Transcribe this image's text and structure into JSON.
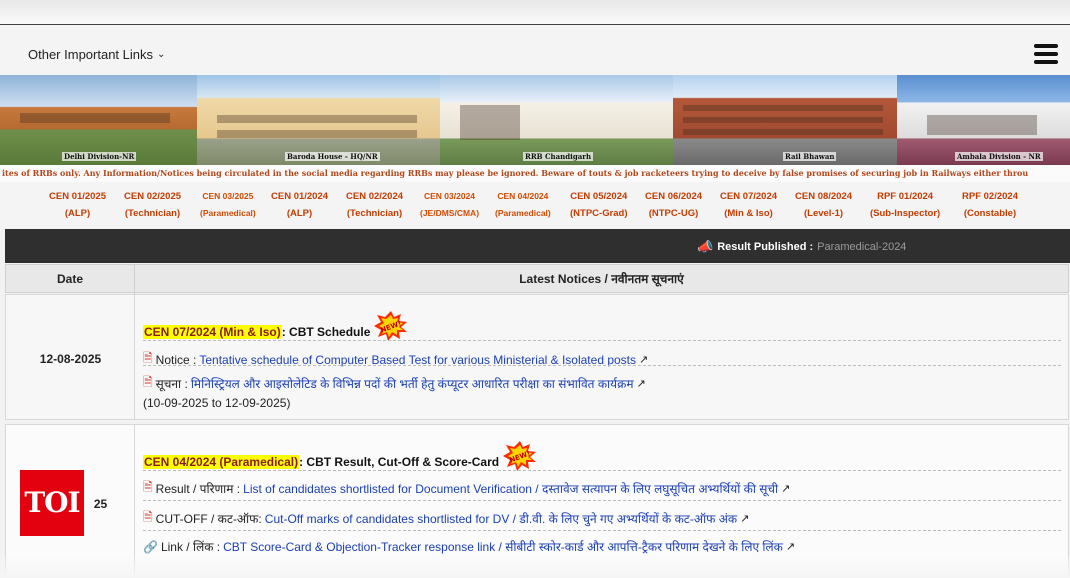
{
  "nav": {
    "links_label": "Other Important Links",
    "menu_icon": "hamburger-icon"
  },
  "banner": {
    "captions": [
      "Delhi Division-NR",
      "Baroda House - HQ/NR",
      "RRB Chandigarh",
      "Rail Bhawan",
      "Ambala Division - NR"
    ]
  },
  "ticker": "ites of RRBs only. Any Information/Notices being circulated in the social media regarding RRBs may please be ignored. Beware of touts & job racketeers trying to deceive by false promises of securing job in Railways either throu",
  "cen_links": [
    {
      "line1": "CEN 01/2025",
      "line2": "(ALP)"
    },
    {
      "line1": "CEN 02/2025",
      "line2": "(Technician)"
    },
    {
      "line1": "CEN 03/2025",
      "line2": "(Paramedical)"
    },
    {
      "line1": "CEN 01/2024",
      "line2": "(ALP)"
    },
    {
      "line1": "CEN 02/2024",
      "line2": "(Technician)"
    },
    {
      "line1": "CEN 03/2024",
      "line2": "(JE/DMS/CMA)"
    },
    {
      "line1": "CEN 04/2024",
      "line2": "(Paramedical)"
    },
    {
      "line1": "CEN 05/2024",
      "line2": "(NTPC-Grad)"
    },
    {
      "line1": "CEN 06/2024",
      "line2": "(NTPC-UG)"
    },
    {
      "line1": "CEN 07/2024",
      "line2": "(Min & Iso)"
    },
    {
      "line1": "CEN 08/2024",
      "line2": "(Level-1)"
    },
    {
      "line1": "RPF 01/2024",
      "line2": "(Sub-Inspector)"
    },
    {
      "line1": "RPF 02/2024",
      "line2": "(Constable)"
    }
  ],
  "result_bar": {
    "label": "Result Published :",
    "value": "Paramedical-2024"
  },
  "table": {
    "headers": {
      "date": "Date",
      "notices": "Latest Notices / नवीनतम सूचनाएं"
    },
    "rows": [
      {
        "date": "12-08-2025",
        "heading_highlight": "CEN 07/2024 (Min & Iso)",
        "heading_rest": " : CBT Schedule",
        "lines": [
          {
            "prefix": "Notice :",
            "link": "Tentative schedule of Computer Based Test for various Ministerial & Isolated posts"
          },
          {
            "prefix": "सूचना :",
            "link": "मिनिस्ट्रियल और आइसोलेटिड के विभिन्न पदों की भर्ती हेतु कंप्यूटर आधारित परीक्षा का संभावित कार्यक्रम"
          }
        ],
        "note": "(10-09-2025 to 12-09-2025)"
      },
      {
        "date": "25",
        "heading_highlight": "CEN 04/2024 (Paramedical)",
        "heading_rest": " : CBT Result, Cut-Off & Score-Card",
        "lines": [
          {
            "prefix": "Result / परिणाम :",
            "link": "List of candidates shortlisted for Document Verification / दस्तावेज सत्यापन के लिए लघुसूचित अभ्यर्थियों की सूची"
          },
          {
            "prefix": "CUT-OFF / कट-ऑफ:",
            "link": "Cut-Off marks of candidates shortlisted for DV / डी.वी. के लिए चुने गए अभ्यर्थियों के कट-ऑफ अंक"
          },
          {
            "prefix": "Link / लिंक :",
            "link": "CBT Score-Card & Objection-Tracker response link / सीबीटी स्कोर-कार्ड और आपत्ति-ट्रैकर परिणाम देखने के लिए लिंक"
          }
        ]
      }
    ]
  },
  "new_badge": "NEW!",
  "watermark": "TOI",
  "colors": {
    "accent_red": "#c0392b",
    "link_blue": "#1a3fb3",
    "highlight": "#ffff00",
    "result_bar": "#2f2f2f",
    "toi_red": "#e3000f"
  }
}
